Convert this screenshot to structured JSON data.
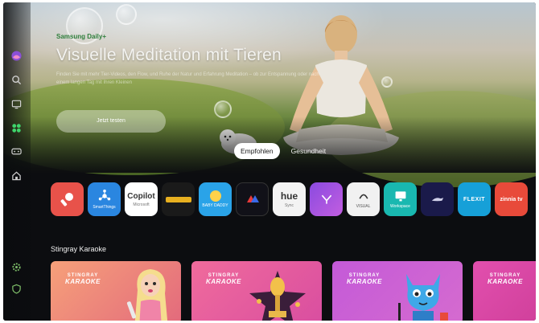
{
  "hero": {
    "brand": "Samsung Daily+",
    "title": "Visuelle Meditation mit Tieren",
    "description": "Finden Sie mit mehr Tier-Videos, den Flow, und Ruhe der Natur und Erfahrung Meditation – ob zur Entspannung oder nach einem langen Tag mit Ihren Kleinen",
    "cta_label": "Jetzt testen"
  },
  "tabs": [
    {
      "label": "Empfohlen",
      "active": true
    },
    {
      "label": "Gesundheit",
      "active": false
    }
  ],
  "sidebar": {
    "items": [
      {
        "name": "profile",
        "icon": "profile-avatar-icon"
      },
      {
        "name": "search",
        "icon": "search-icon"
      },
      {
        "name": "ambient",
        "icon": "ambient-mode-icon"
      },
      {
        "name": "apps",
        "icon": "apps-icon",
        "active": true
      },
      {
        "name": "game",
        "icon": "game-controller-icon"
      },
      {
        "name": "home",
        "icon": "home-icon"
      },
      {
        "name": "settings",
        "icon": "gear-icon"
      },
      {
        "name": "privacy",
        "icon": "shield-icon"
      }
    ],
    "accent": "#3fd46b"
  },
  "apps": [
    {
      "name": "karaoke",
      "label": "",
      "color": "#e8524a",
      "icon": "microphone-icon"
    },
    {
      "name": "smartthings",
      "label": "SmartThings",
      "color": "#2a86e0",
      "icon": "smartthings-icon"
    },
    {
      "name": "copilot",
      "label": "Copilot",
      "sub": "Microsoft",
      "color": "#ffffff"
    },
    {
      "name": "wordmark",
      "label": "",
      "color": "#1a1a1a"
    },
    {
      "name": "baby-daddy",
      "label": "BABY DADDY",
      "color": "#2aa3e8"
    },
    {
      "name": "ride",
      "label": "",
      "color": "#111118"
    },
    {
      "name": "hue",
      "label": "hue",
      "sub": "Sync",
      "color": "#f3f3f3"
    },
    {
      "name": "yoga",
      "label": "",
      "color": "#9b4fe0"
    },
    {
      "name": "visual-tune",
      "label": "VISUAL",
      "color": "#f1f1f1"
    },
    {
      "name": "workspace",
      "label": "Workspace",
      "color": "#19b8b0"
    },
    {
      "name": "panther",
      "label": "",
      "color": "#1a1a4a"
    },
    {
      "name": "flexit",
      "label": "FLEXIT",
      "color": "#16a0d8"
    },
    {
      "name": "zinnia",
      "label": "zinnia tv",
      "color": "#e84a3a"
    }
  ],
  "karaoke": {
    "title": "Stingray Karaoke",
    "cards": [
      {
        "logo_top": "STINGRAY",
        "logo_bottom": "KARAOKE",
        "color_a": "#f6a07a",
        "color_b": "#e36a7c"
      },
      {
        "logo_top": "STINGRAY",
        "logo_bottom": "KARAOKE",
        "color_a": "#f06b9c",
        "color_b": "#d94ea0"
      },
      {
        "logo_top": "STINGRAY",
        "logo_bottom": "KARAOKE",
        "color_a": "#c45ad8",
        "color_b": "#d56bcf"
      },
      {
        "logo_top": "STINGRAY",
        "logo_bottom": "KARAOKE",
        "color_a": "#e24fae",
        "color_b": "#cf3f9a"
      }
    ]
  }
}
